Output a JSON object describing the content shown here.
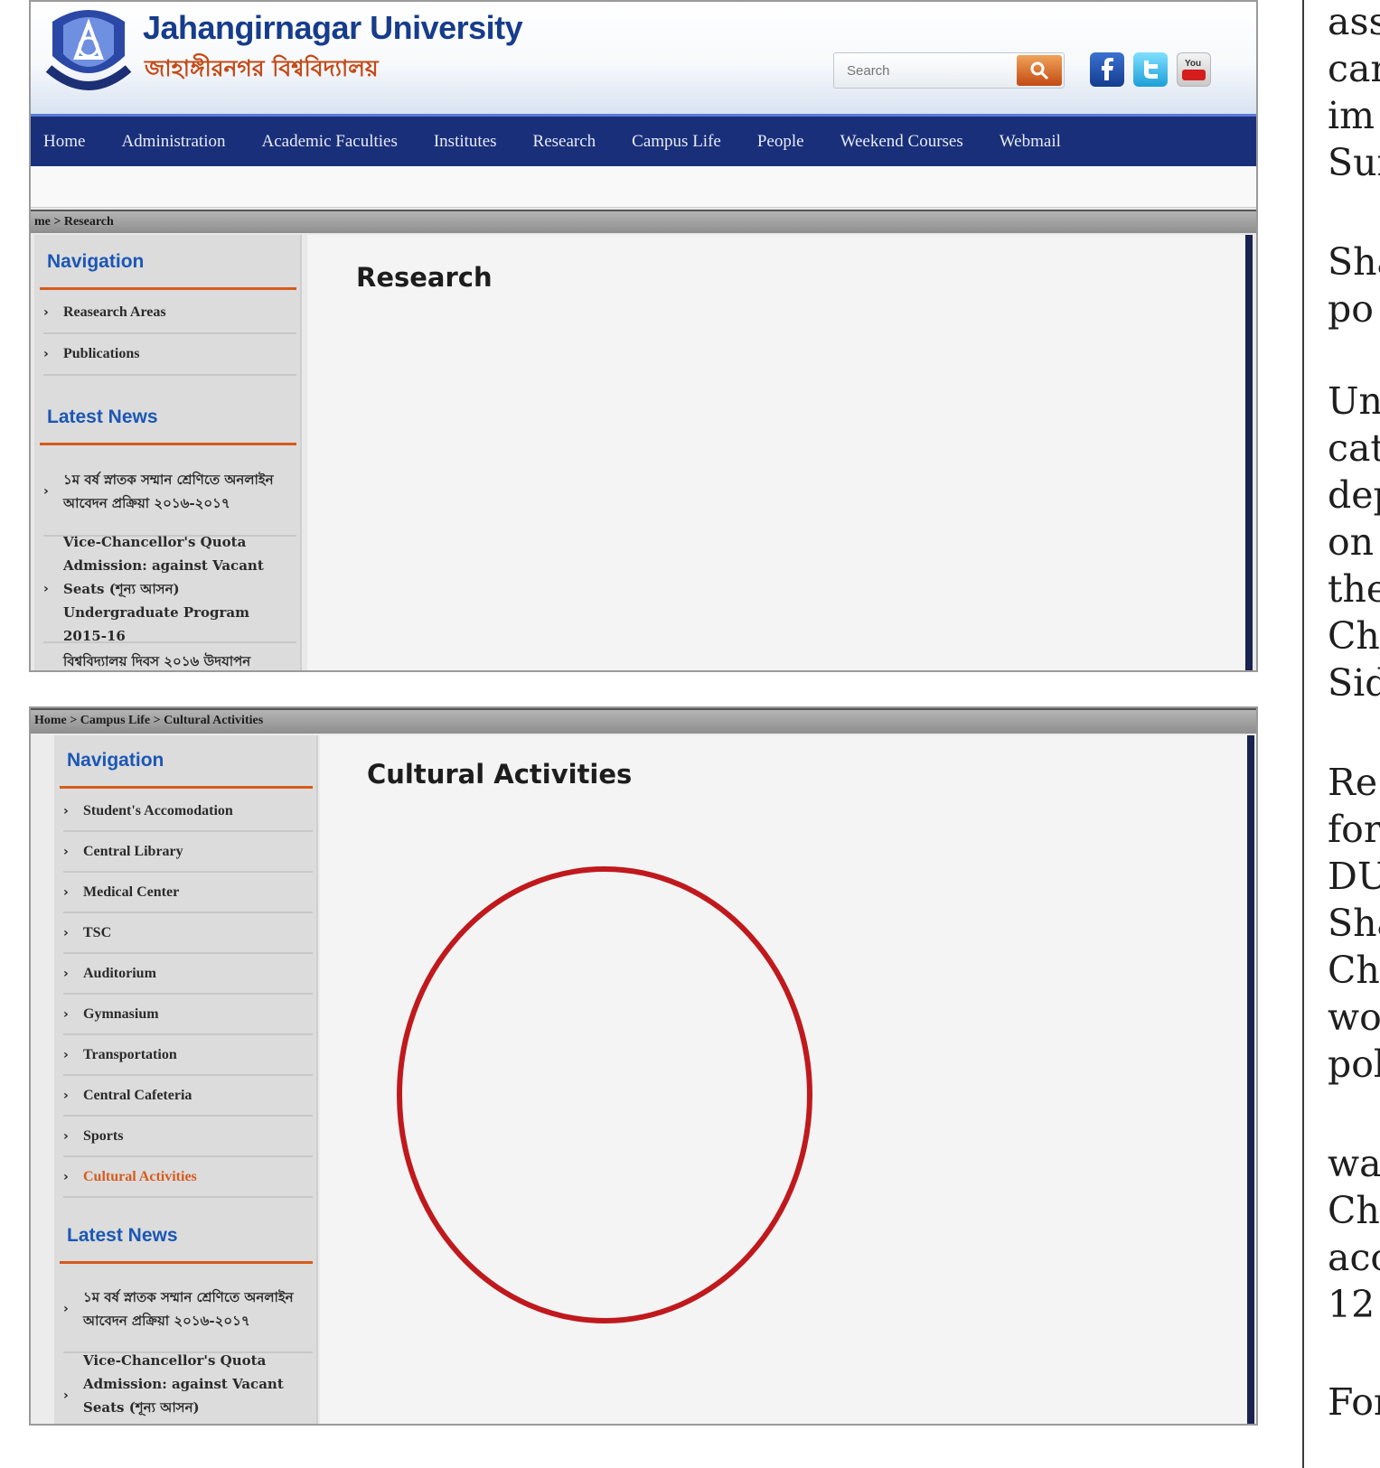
{
  "screenshot1": {
    "university_name_en": "Jahangirnagar University",
    "university_name_bn": "জাহাঙ্গীরনগর বিশ্ববিদ্যালয়",
    "search_placeholder": "Search",
    "nav": [
      "Home",
      "Administration",
      "Academic Faculties",
      "Institutes",
      "Research",
      "Campus Life",
      "People",
      "Weekend Courses",
      "Webmail"
    ],
    "breadcrumb": "me  > Research",
    "sidebar": {
      "navigation_heading": "Navigation",
      "nav_items": [
        "Reasearch Areas",
        "Publications"
      ],
      "news_heading": "Latest News",
      "news_items": [
        "১ম বর্ষ স্নাতক সম্মান শ্রেণিতে অনলাইন আবেদন প্রক্রিয়া ২০১৬-২০১৭",
        "Vice-Chancellor's Quota Admission: against Vacant Seats (শূন্য আসন) Undergraduate Program 2015-16",
        "বিশ্ববিদ্যালয় দিবস ২০১৬ উদযাপন"
      ]
    },
    "page_title": "Research"
  },
  "screenshot2": {
    "breadcrumb": "Home  > Campus Life  > Cultural Activities",
    "sidebar": {
      "navigation_heading": "Navigation",
      "nav_items": [
        "Student's Accomodation",
        "Central Library",
        "Medical Center",
        "TSC",
        "Auditorium",
        "Gymnasium",
        "Transportation",
        "Central Cafeteria",
        "Sports",
        "Cultural Activities"
      ],
      "active_item": "Cultural Activities",
      "news_heading": "Latest News",
      "news_items": [
        "১ম বর্ষ স্নাতক সম্মান শ্রেণিতে অনলাইন আবেদন প্রক্রিয়া ২০১৬-২০১৭",
        "Vice-Chancellor's Quota Admission: against Vacant Seats (শূন্য আসন) Undergraduate"
      ]
    },
    "page_title": "Cultural Activities"
  },
  "newspaper_column": [
    "ass",
    "car",
    "im",
    "Sur",
    "Sha",
    "po",
    "Un",
    "cat",
    "dep",
    "on",
    "the",
    "Ch",
    "Sid",
    "Re",
    "for",
    "DU",
    "Sha",
    "Ch",
    "wo",
    "pol",
    "wa",
    "Ch",
    "acc",
    "12",
    "For"
  ],
  "colors": {
    "nav_bg": "#1a2f7a",
    "heading_blue": "#1b57b5",
    "accent_orange": "#d75b1c",
    "highlight_circle": "#c0191d"
  },
  "icons": [
    "logo-emblem",
    "search-icon",
    "facebook-icon",
    "twitter-icon",
    "youtube-icon",
    "chevron-right-icon"
  ]
}
